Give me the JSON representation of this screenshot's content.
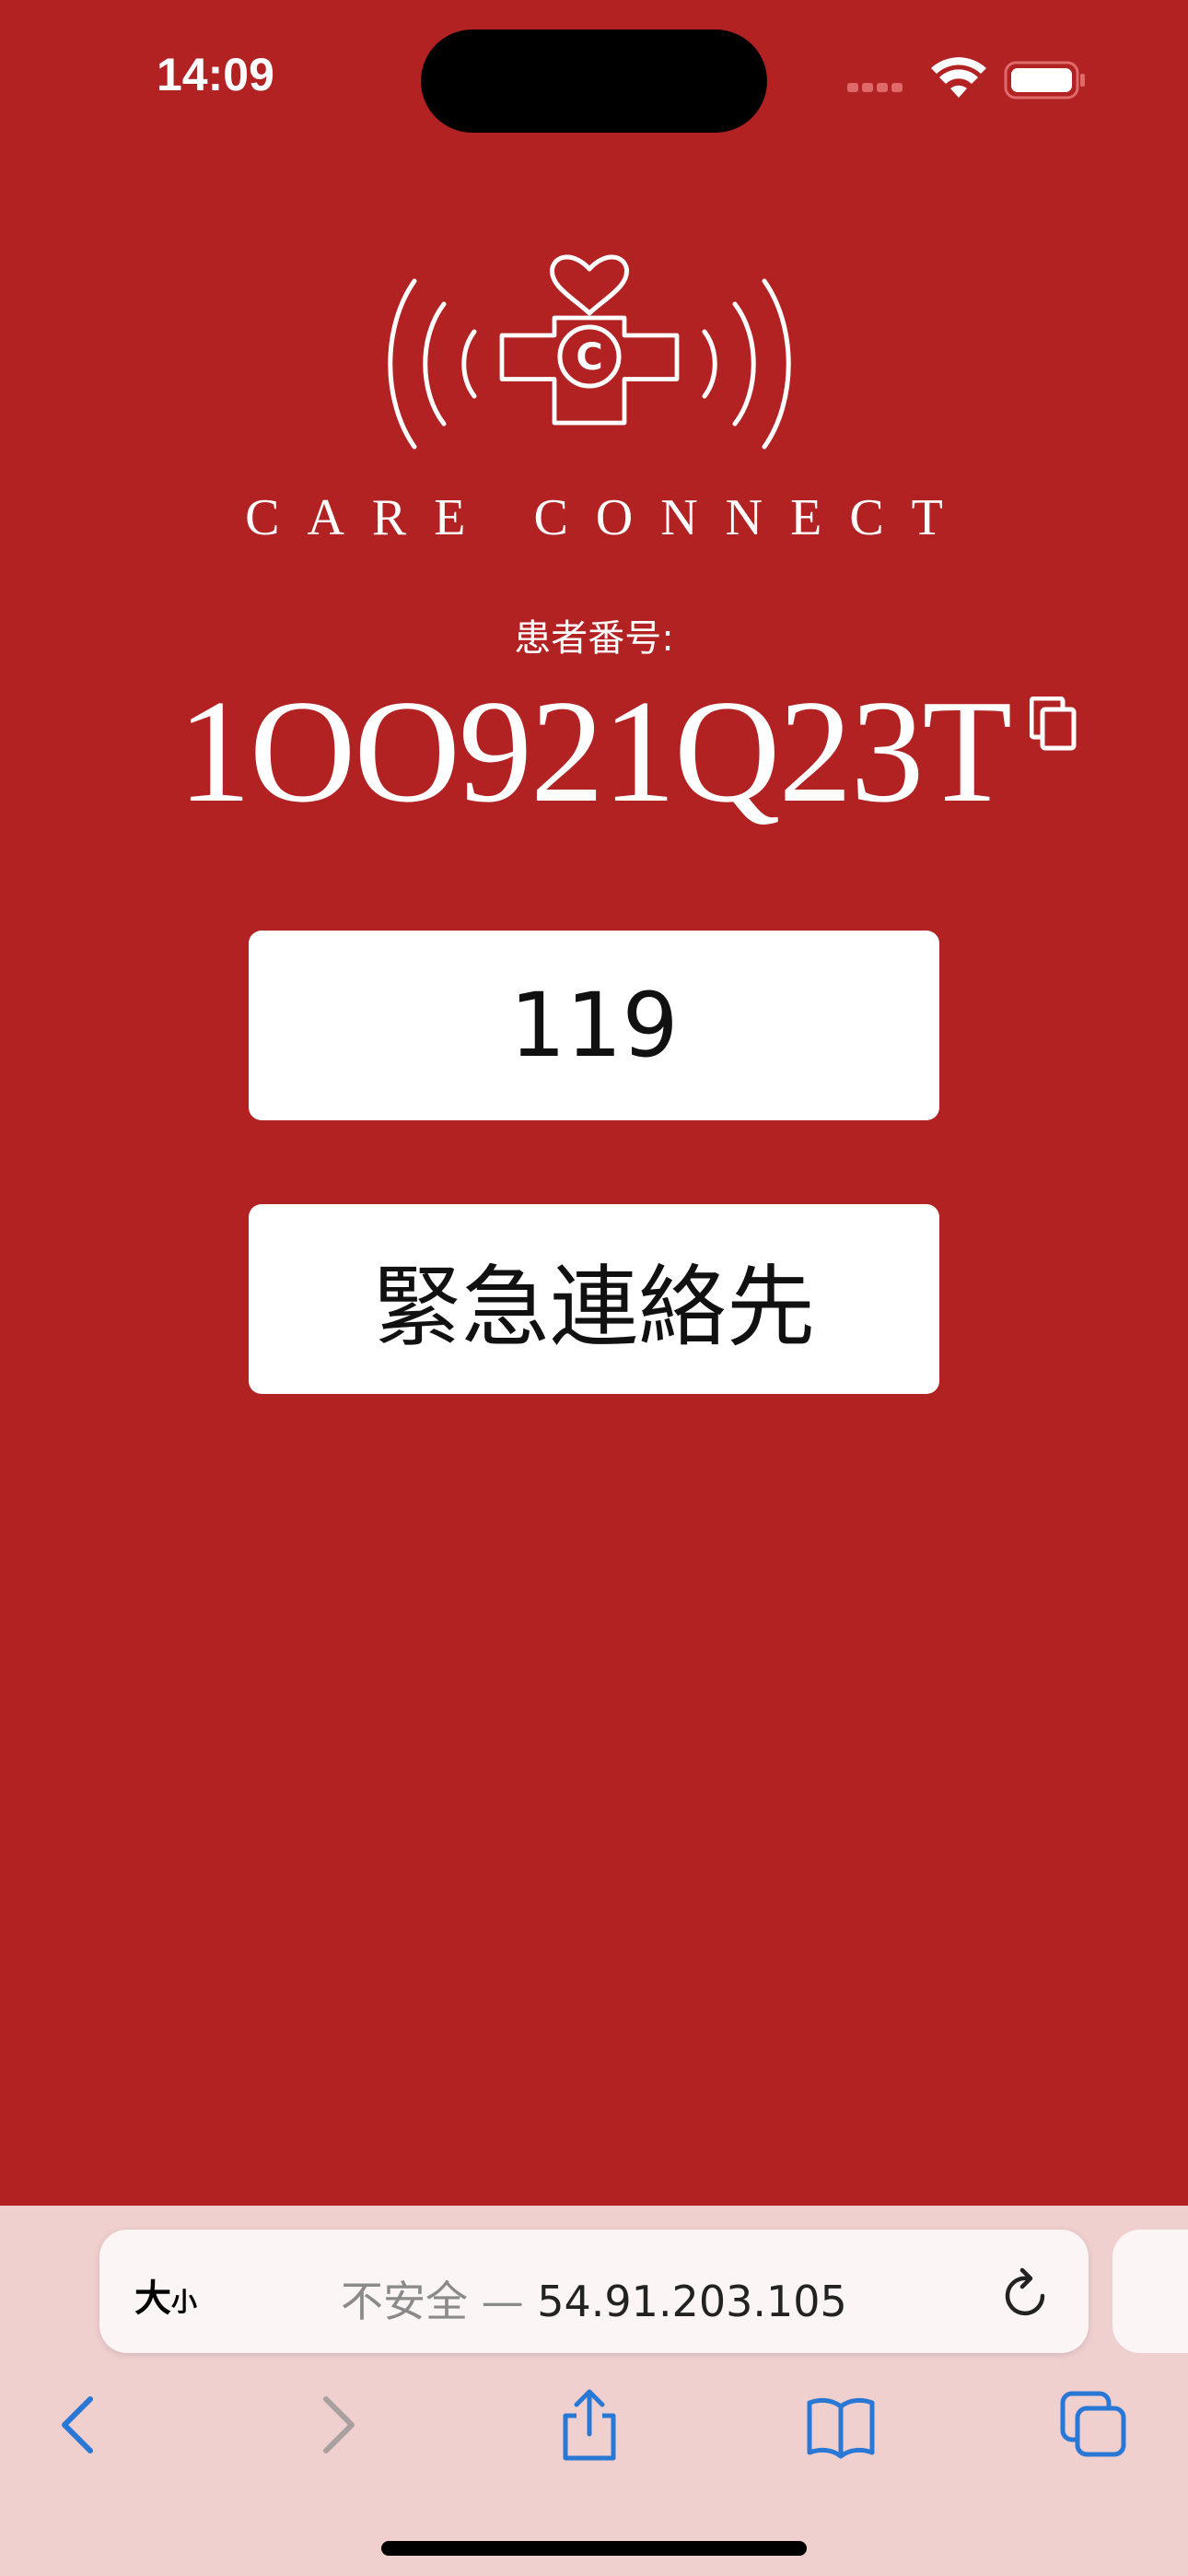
{
  "status_bar": {
    "time": "14:09"
  },
  "brand": {
    "name": "CARE CONNECT",
    "logo_icon": "care-connect-logo"
  },
  "patient": {
    "label": "患者番号:",
    "number": "1OO921Q23T"
  },
  "actions": {
    "emergency_call": "119",
    "emergency_contact": "緊急連絡先"
  },
  "browser": {
    "text_size_big": "大",
    "text_size_small": "小",
    "security_label": "不安全 — ",
    "url": "54.91.203.105"
  },
  "colors": {
    "background": "#b22222",
    "button": "#ffffff",
    "toolbar": "#f0cfcf",
    "accent": "#2a78d6"
  }
}
